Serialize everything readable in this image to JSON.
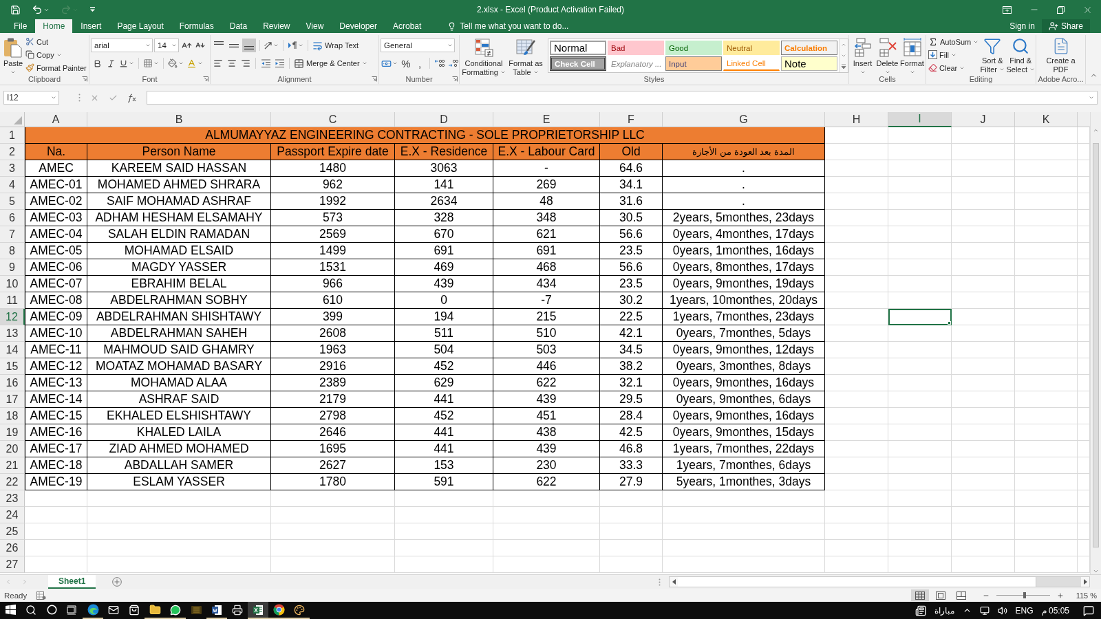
{
  "window": {
    "title": "2.xlsx - Excel (Product Activation Failed)"
  },
  "quick_access": [
    {
      "kind": "save",
      "disabled": false
    },
    {
      "kind": "undo",
      "disabled": false
    },
    {
      "kind": "redo",
      "disabled": true
    },
    {
      "kind": "customize",
      "disabled": false
    }
  ],
  "ribbon_tabs": [
    {
      "label": "File",
      "selected": false
    },
    {
      "label": "Home",
      "selected": true
    },
    {
      "label": "Insert",
      "selected": false
    },
    {
      "label": "Page Layout",
      "selected": false
    },
    {
      "label": "Formulas",
      "selected": false
    },
    {
      "label": "Data",
      "selected": false
    },
    {
      "label": "Review",
      "selected": false
    },
    {
      "label": "View",
      "selected": false
    },
    {
      "label": "Developer",
      "selected": false
    },
    {
      "label": "Acrobat",
      "selected": false
    }
  ],
  "tell_me": "Tell me what you want to do...",
  "account": {
    "sign_in": "Sign in",
    "share": "Share"
  },
  "ribbon": {
    "clipboard": {
      "label": "Clipboard",
      "paste": "Paste",
      "cut": "Cut",
      "copy": "Copy",
      "format_painter": "Format Painter"
    },
    "font": {
      "label": "Font",
      "font_name": "arial",
      "font_size": "14"
    },
    "alignment": {
      "label": "Alignment",
      "vertical": [
        {
          "kind": "top",
          "selected": false
        },
        {
          "kind": "middle",
          "selected": false
        },
        {
          "kind": "bottom",
          "selected": true
        }
      ],
      "wrap_text": "Wrap Text",
      "merge_center": "Merge & Center"
    },
    "number": {
      "label": "Number",
      "format": "General",
      "percent": "%",
      "comma": ","
    },
    "styles": {
      "label": "Styles",
      "conditional_formatting": "Conditional Formatting",
      "format_as_table": "Format as Table",
      "gallery": [
        {
          "label": "Normal",
          "kind": "normal",
          "selected": true
        },
        {
          "label": "Bad",
          "kind": "bad",
          "selected": false
        },
        {
          "label": "Good",
          "kind": "good",
          "selected": false
        },
        {
          "label": "Neutral",
          "kind": "neutral",
          "selected": false
        },
        {
          "label": "Calculation",
          "kind": "calculation",
          "selected": false
        },
        {
          "label": "Check Cell",
          "kind": "check",
          "selected": false
        },
        {
          "label": "Explanatory ...",
          "kind": "explanatory",
          "selected": false
        },
        {
          "label": "Input",
          "kind": "input",
          "selected": false
        },
        {
          "label": "Linked Cell",
          "kind": "linked",
          "selected": false
        },
        {
          "label": "Note",
          "kind": "note",
          "selected": false
        }
      ]
    },
    "cells": {
      "label": "Cells",
      "buttons": [
        {
          "label": "Insert",
          "kind": "insert"
        },
        {
          "label": "Delete",
          "kind": "delete"
        },
        {
          "label": "Format",
          "kind": "format"
        }
      ]
    },
    "editing": {
      "label": "Editing",
      "autosum": "AutoSum",
      "fill": "Fill",
      "clear": "Clear",
      "sort_filter": "Sort & Filter",
      "find_select": "Find & Select"
    },
    "acrobat": {
      "label": "Adobe Acro...",
      "create_pdf": "Create a PDF"
    }
  },
  "formula_bar": {
    "name_box": "I12"
  },
  "sheet": {
    "columns": [
      {
        "label": "A",
        "selected": false
      },
      {
        "label": "B",
        "selected": false
      },
      {
        "label": "C",
        "selected": false
      },
      {
        "label": "D",
        "selected": false
      },
      {
        "label": "E",
        "selected": false
      },
      {
        "label": "F",
        "selected": false
      },
      {
        "label": "G",
        "selected": false
      },
      {
        "label": "H",
        "selected": false
      },
      {
        "label": "I",
        "selected": true
      },
      {
        "label": "J",
        "selected": false
      },
      {
        "label": "K",
        "selected": false
      }
    ],
    "row_numbers": [
      {
        "label": "1",
        "selected": false
      },
      {
        "label": "2",
        "selected": false
      },
      {
        "label": "3",
        "selected": false
      },
      {
        "label": "4",
        "selected": false
      },
      {
        "label": "5",
        "selected": false
      },
      {
        "label": "6",
        "selected": false
      },
      {
        "label": "7",
        "selected": false
      },
      {
        "label": "8",
        "selected": false
      },
      {
        "label": "9",
        "selected": false
      },
      {
        "label": "10",
        "selected": false
      },
      {
        "label": "11",
        "selected": false
      },
      {
        "label": "12",
        "selected": true
      },
      {
        "label": "13",
        "selected": false
      },
      {
        "label": "14",
        "selected": false
      },
      {
        "label": "15",
        "selected": false
      },
      {
        "label": "16",
        "selected": false
      },
      {
        "label": "17",
        "selected": false
      },
      {
        "label": "18",
        "selected": false
      },
      {
        "label": "19",
        "selected": false
      },
      {
        "label": "20",
        "selected": false
      },
      {
        "label": "21",
        "selected": false
      },
      {
        "label": "22",
        "selected": false
      },
      {
        "label": "23",
        "selected": false
      },
      {
        "label": "24",
        "selected": false
      },
      {
        "label": "25",
        "selected": false
      },
      {
        "label": "26",
        "selected": false
      },
      {
        "label": "27",
        "selected": false
      }
    ],
    "title": "ALMUMAYYAZ ENGINEERING CONTRACTING - SOLE PROPRIETORSHIP LLC",
    "headers": [
      {
        "label": "Na.",
        "kind": "latin"
      },
      {
        "label": "Person Name",
        "kind": "latin"
      },
      {
        "label": "Passport Expire date",
        "kind": "latin"
      },
      {
        "label": "E.X - Residence",
        "kind": "latin"
      },
      {
        "label": "E.X - Labour Card",
        "kind": "latin"
      },
      {
        "label": "Old",
        "kind": "latin"
      },
      {
        "label": "المدة بعد العودة من الأجازة",
        "kind": "arabic"
      }
    ],
    "rows": [
      [
        "AMEC",
        "KAREEM SAID HASSAN",
        "1480",
        "3063",
        "-",
        "64.6",
        "."
      ],
      [
        "AMEC-01",
        "MOHAMED AHMED SHRARA",
        "962",
        "141",
        "269",
        "34.1",
        "."
      ],
      [
        "AMEC-02",
        "SAIF MOHAMAD ASHRAF",
        "1992",
        "2634",
        "48",
        "31.6",
        "."
      ],
      [
        "AMEC-03",
        "ADHAM HESHAM ELSAMAHY",
        "573",
        "328",
        "348",
        "30.5",
        "2years, 5monthes, 23days"
      ],
      [
        "AMEC-04",
        "SALAH ELDIN RAMADAN",
        "2569",
        "670",
        "621",
        "56.6",
        "0years, 4monthes, 17days"
      ],
      [
        "AMEC-05",
        "MOHAMAD ELSAID",
        "1499",
        "691",
        "691",
        "23.5",
        "0years, 1monthes, 16days"
      ],
      [
        "AMEC-06",
        "MAGDY YASSER",
        "1531",
        "469",
        "468",
        "56.6",
        "0years, 8monthes, 17days"
      ],
      [
        "AMEC-07",
        "EBRAHIM BELAL",
        "966",
        "439",
        "434",
        "23.5",
        "0years, 9monthes, 19days"
      ],
      [
        "AMEC-08",
        "ABDELRAHMAN SOBHY",
        "610",
        "0",
        "-7",
        "30.2",
        "1years, 10monthes, 20days"
      ],
      [
        "AMEC-09",
        "ABDELRAHMAN SHISHTAWY",
        "399",
        "194",
        "215",
        "22.5",
        "1years, 7monthes, 23days"
      ],
      [
        "AMEC-10",
        "ABDELRAHMAN SAHEH",
        "2608",
        "511",
        "510",
        "42.1",
        "0years, 7monthes, 5days"
      ],
      [
        "AMEC-11",
        "MAHMOUD SAID GHAMRY",
        "1963",
        "504",
        "503",
        "34.5",
        "0years, 9monthes, 12days"
      ],
      [
        "AMEC-12",
        "MOATAZ MOHAMAD BASARY",
        "2916",
        "452",
        "446",
        "38.2",
        "0years, 3monthes, 8days"
      ],
      [
        "AMEC-13",
        "MOHAMAD ALAA",
        "2389",
        "629",
        "622",
        "32.1",
        "0years, 9monthes, 16days"
      ],
      [
        "AMEC-14",
        "ASHRAF SAID",
        "2179",
        "441",
        "439",
        "29.5",
        "0years, 9monthes, 6days"
      ],
      [
        "AMEC-15",
        "EKHALED ELSHISHTAWY",
        "2798",
        "452",
        "451",
        "28.4",
        "0years, 9monthes, 16days"
      ],
      [
        "AMEC-16",
        "KHALED LAILA",
        "2646",
        "441",
        "438",
        "42.5",
        "0years, 9monthes, 15days"
      ],
      [
        "AMEC-17",
        "ZIAD AHMED MOHAMED",
        "1695",
        "441",
        "439",
        "46.8",
        "1years, 7monthes, 22days"
      ],
      [
        "AMEC-18",
        "ABDALLAH SAMER",
        "2627",
        "153",
        "230",
        "33.3",
        "1years, 7monthes, 6days"
      ],
      [
        "AMEC-19",
        "ESLAM YASSER",
        "1780",
        "591",
        "622",
        "27.9",
        "5years, 1monthes, 3days"
      ]
    ]
  },
  "sheet_tabs": [
    {
      "label": "Sheet1",
      "selected": true
    }
  ],
  "status_bar": {
    "mode": "Ready",
    "views": [
      {
        "kind": "normal",
        "selected": true
      },
      {
        "kind": "page_layout",
        "selected": false
      },
      {
        "kind": "page_break",
        "selected": false
      }
    ],
    "zoom_slider": {
      "level": 0.53
    },
    "zoom": "115 %"
  },
  "taskbar": {
    "apps": [
      {
        "kind": "start",
        "running": false,
        "active": false
      },
      {
        "kind": "search",
        "running": false,
        "active": false
      },
      {
        "kind": "cortana",
        "running": false,
        "active": false
      },
      {
        "kind": "task_view",
        "running": false,
        "active": false
      },
      {
        "kind": "edge",
        "running": true,
        "active": false
      },
      {
        "kind": "mail",
        "running": false,
        "active": false
      },
      {
        "kind": "store",
        "running": false,
        "active": false
      },
      {
        "kind": "explorer",
        "running": true,
        "active": false
      },
      {
        "kind": "whatsapp",
        "running": true,
        "active": false
      },
      {
        "kind": "media",
        "running": false,
        "active": false
      },
      {
        "kind": "word",
        "running": true,
        "active": false
      },
      {
        "kind": "printer",
        "running": false,
        "active": false
      },
      {
        "kind": "excel",
        "running": true,
        "active": true
      },
      {
        "kind": "chrome",
        "running": true,
        "active": false
      },
      {
        "kind": "paint",
        "running": true,
        "active": false
      }
    ],
    "tray": {
      "news": "مباراة",
      "language": "ENG",
      "time": "05:05 م"
    }
  }
}
